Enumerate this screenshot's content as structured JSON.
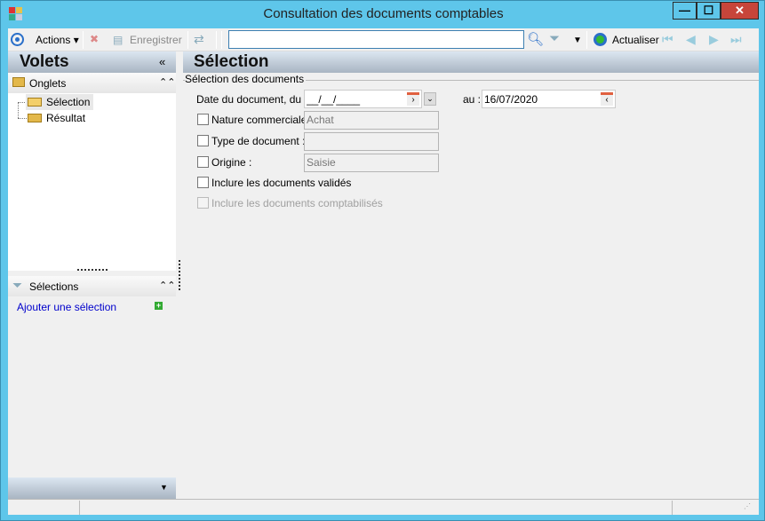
{
  "window": {
    "title": "Consultation des documents comptables",
    "min": "—",
    "max": "☐",
    "close": "✕"
  },
  "toolbar": {
    "actions": "Actions",
    "save": "Enregistrer",
    "search_value": "",
    "refresh": "Actualiser"
  },
  "left": {
    "title": "Volets",
    "collapse": "«",
    "onglets": "Onglets",
    "tabs": [
      "Sélection",
      "Résultat"
    ],
    "selections": "Sélections",
    "add_selection": "Ajouter une sélection"
  },
  "main": {
    "title": "Sélection",
    "group": "Sélection des documents",
    "date_label": "Date du document, du :",
    "date_from": "__/__/____",
    "au_label": "au :",
    "date_to": "16/07/2020",
    "nature_label": "Nature commerciale :",
    "nature_value": "Achat",
    "type_label": "Type de document :",
    "type_value": "",
    "origine_label": "Origine :",
    "origine_value": "Saisie",
    "valides_label": "Inclure les documents validés",
    "comptabilises_label": "Inclure les documents comptabilisés"
  },
  "colors": {
    "frame": "#5ec6ea",
    "link": "#0000cc"
  }
}
